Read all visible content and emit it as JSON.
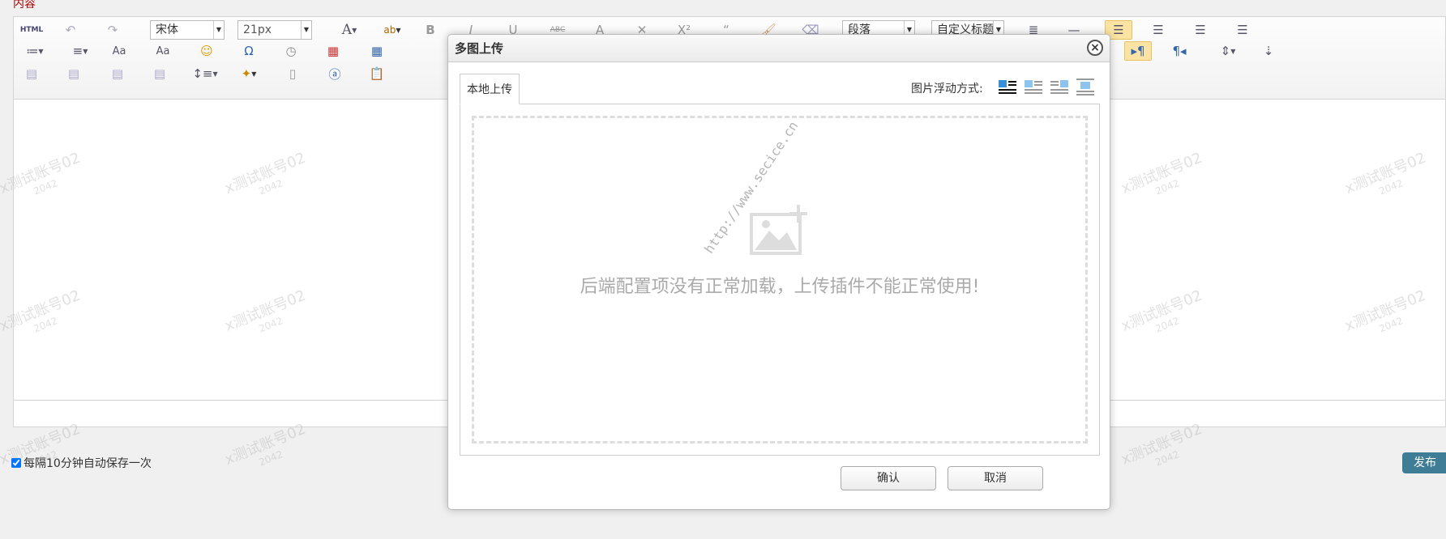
{
  "page": {
    "field_label": "内容",
    "autosave_label": "每隔10分钟自动保存一次",
    "autosave_checked": true,
    "publish_label": "发布"
  },
  "toolbar": {
    "html_label": "HTML",
    "font_family": "宋体",
    "font_size": "21px",
    "paragraph_format": "段落",
    "custom_heading": "自定义标题"
  },
  "dialog": {
    "title": "多图上传",
    "close_symbol": "×",
    "tab_local": "本地上传",
    "float_label": "图片浮动方式:",
    "error_message": "后端配置项没有正常加载，上传插件不能正常使用!",
    "confirm_label": "确认",
    "cancel_label": "取消",
    "site_watermark": "http://www.secice.cn"
  },
  "watermark": {
    "line1": "x测试账号02",
    "line2": "2042"
  },
  "colors": {
    "accent_publish": "#3f7d96",
    "label_red": "#aa0000",
    "active_button": "#fbe3a3"
  }
}
